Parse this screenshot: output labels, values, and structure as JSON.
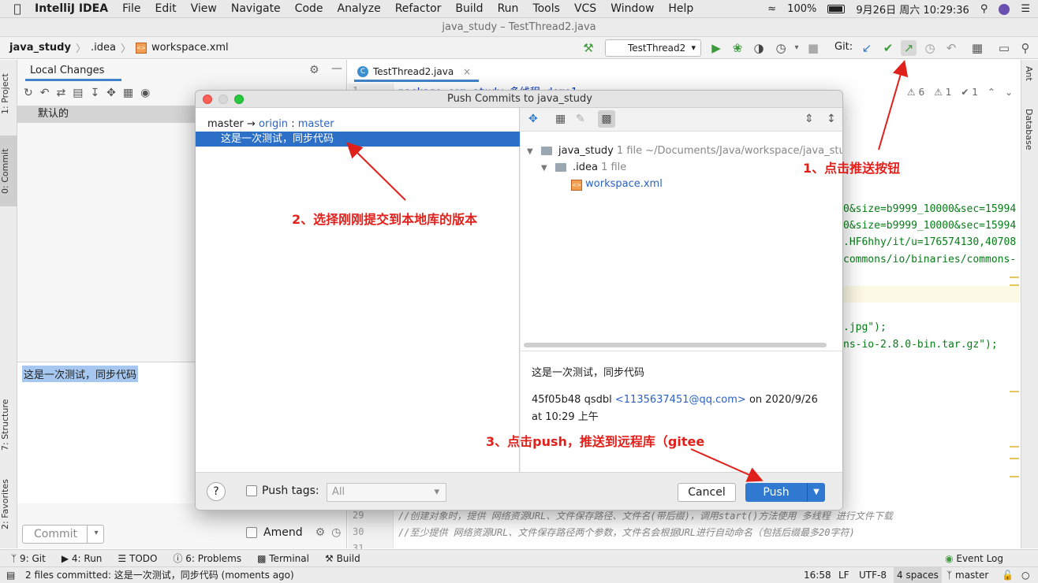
{
  "menubar": {
    "app_name": "IntelliJ IDEA",
    "items": [
      "File",
      "Edit",
      "View",
      "Navigate",
      "Code",
      "Analyze",
      "Refactor",
      "Build",
      "Run",
      "Tools",
      "VCS",
      "Window",
      "Help"
    ],
    "battery": "100%",
    "datetime": "9月26日 周六  10:29:36"
  },
  "window": {
    "title": "java_study – TestThread2.java"
  },
  "breadcrumb": {
    "project": "java_study",
    "folder": ".idea",
    "file": "workspace.xml"
  },
  "toolbar": {
    "run_config": "TestThread2",
    "git_label": "Git:"
  },
  "left_strip": {
    "project_tab": "1: Project",
    "commit_tab": "0: Commit",
    "structure_tab": "7: Structure",
    "favorites_tab": "2: Favorites"
  },
  "right_strip": {
    "ant_tab": "Ant",
    "database_tab": "Database"
  },
  "commit_panel": {
    "tab_label": "Local Changes",
    "changelist": "默认的",
    "message": "这是一次测试，同步代码",
    "commit_button": "Commit",
    "amend_label": "Amend"
  },
  "editor": {
    "tab_label": "TestThread2.java",
    "inspections": {
      "warnings": "6",
      "weak": "1",
      "ok": "1"
    },
    "line1": "package com.study.多线程.demo1;",
    "frag1": "0&size=b9999_10000&sec=15994",
    "frag2": "0&size=b9999_10000&sec=15994",
    "frag3": ".HF6hhy/it/u=176574130,40708",
    "frag4": "commons/io/binaries/commons-",
    "frag5": ".jpg\");",
    "frag6": "ns-io-2.8.0-bin.tar.gz\");",
    "ln29": "29",
    "ln30": "30",
    "ln31": "31",
    "ln1": "1",
    "comment29": "//创建对象时，提供 网络资源URL、文件保存路径、文件名(带后缀)，调用start()方法使用 多线程 进行文件下载",
    "comment30": "//至少提供 网络资源URL、文件保存路径两个参数，文件名会根据URL进行自动命名（包括后缀最多20字符)"
  },
  "dialog": {
    "title": "Push Commits to java_study",
    "branch_local": "master",
    "branch_arrow": "→",
    "remote": "origin",
    "branch_remote": "master",
    "commit_message": "这是一次测试，同步代码",
    "tree": {
      "root_name": "java_study",
      "root_count": "1 file",
      "root_path": "~/Documents/Java/workspace/java_stu",
      "folder_name": ".idea",
      "folder_count": "1 file",
      "file_name": "workspace.xml"
    },
    "details": {
      "message": "这是一次测试，同步代码",
      "hash": "45f05b48",
      "author": "qsdbl",
      "email": "<1135637451@qq.com>",
      "date": "on 2020/9/26",
      "time": "at 10:29 上午"
    },
    "push_tags_label": "Push tags:",
    "tags_select": "All",
    "cancel_label": "Cancel",
    "push_label": "Push",
    "help_label": "?"
  },
  "tool_windows": [
    {
      "label": "9: Git"
    },
    {
      "label": "4: Run"
    },
    {
      "label": "TODO"
    },
    {
      "label": "6: Problems"
    },
    {
      "label": "Terminal"
    },
    {
      "label": "Build"
    }
  ],
  "event_log": "Event Log",
  "status": {
    "message": "2 files committed: 这是一次测试，同步代码 (moments ago)",
    "position": "16:58",
    "line_sep": "LF",
    "encoding": "UTF-8",
    "indent": "4 spaces",
    "branch": "master"
  },
  "annotations": {
    "step1": "1、点击推送按钮",
    "step2": "2、选择刚刚提交到本地库的版本",
    "step3": "3、点击push，推送到远程库（gitee"
  },
  "colors": {
    "accent": "#2f7ad0",
    "annotation": "#e0201b",
    "selection": "#2b6fc6"
  }
}
